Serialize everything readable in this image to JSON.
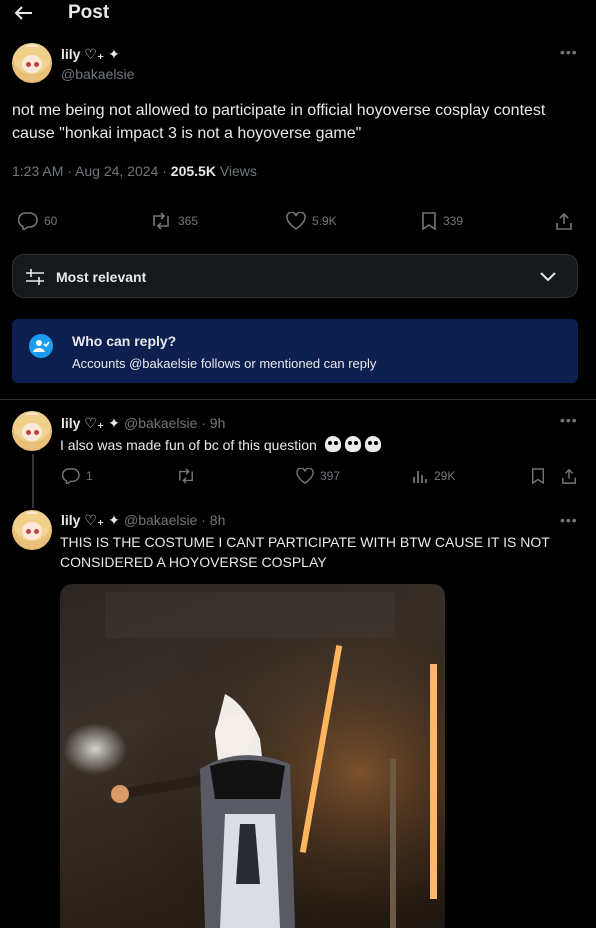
{
  "header": {
    "title": "Post"
  },
  "post": {
    "name": "lily ♡₊ ✦",
    "handle": "@bakaelsie",
    "text": "not me being not allowed to participate in official hoyoverse cosplay contest cause \"honkai impact 3 is not a hoyoverse game\"",
    "time": "1:23 AM · Aug 24, 2024 · ",
    "views": "205.5K",
    "views_label": " Views",
    "replies": "60",
    "reposts": "365",
    "likes": "5.9K",
    "bookmarks": "339"
  },
  "sort": {
    "label": "Most relevant"
  },
  "who_can_reply": {
    "title": "Who can reply?",
    "text": "Accounts @bakaelsie follows or mentioned can reply"
  },
  "replies": [
    {
      "name": "lily ♡₊ ✦",
      "handle": "@bakaelsie · 9h",
      "text": "I also was made fun of bc of this question",
      "replies": "1",
      "reposts": "",
      "likes": "397",
      "views": "29K"
    },
    {
      "name": "lily ♡₊ ✦",
      "handle": "@bakaelsie · 8h",
      "text": "THIS IS THE COSTUME I CANT PARTICIPATE WITH BTW CAUSE IT IS NOT CONSIDERED A HOYOVERSE COSPLAY"
    }
  ],
  "colors": {
    "accent": "#1d9bf0",
    "banner": "#0c1f4e",
    "muted": "#71767b"
  },
  "icons": [
    "back-arrow-icon",
    "more-icon",
    "reply-icon",
    "repost-icon",
    "like-icon",
    "bookmark-icon",
    "share-icon",
    "sort-icon",
    "chevron-down-icon",
    "mention-icon",
    "views-icon",
    "skull-icon"
  ]
}
